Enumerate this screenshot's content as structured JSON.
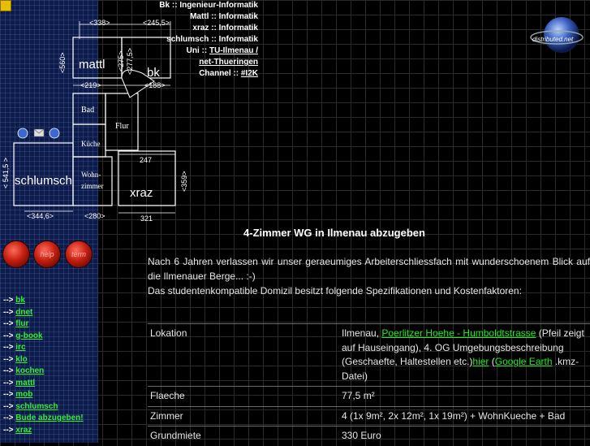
{
  "sidebar_nav": [
    {
      "arrow": "-->",
      "label": "bk"
    },
    {
      "arrow": "-->",
      "label": "dnet"
    },
    {
      "arrow": "-->",
      "label": "flur"
    },
    {
      "arrow": "-->",
      "label": "g-book"
    },
    {
      "arrow": "-->",
      "label": "irc"
    },
    {
      "arrow": "-->",
      "label": "klo"
    },
    {
      "arrow": "-->",
      "label": "kochen"
    },
    {
      "arrow": "-->",
      "label": "mattl"
    },
    {
      "arrow": "-->",
      "label": "mob"
    },
    {
      "arrow": "-->",
      "label": "schlumsch"
    },
    {
      "arrow": "-->",
      "label": "Bude abzugeben!"
    },
    {
      "arrow": "-->",
      "label": "xraz"
    }
  ],
  "round_buttons": [
    "",
    "help",
    "term"
  ],
  "people": [
    {
      "name": "Bk",
      "sep": "::",
      "value": "Ingenieur-Informatik"
    },
    {
      "name": "Mattl",
      "sep": "::",
      "value": "Informatik"
    },
    {
      "name": "xraz",
      "sep": "::",
      "value": "Informatik"
    },
    {
      "name": "schlumsch",
      "sep": "::",
      "value": "Informatik"
    },
    {
      "name": "Uni",
      "sep": "::",
      "value": "TU-Ilmenau /"
    },
    {
      "name": "",
      "sep": "",
      "value": "net-Thueringen"
    },
    {
      "name": "Channel",
      "sep": "::",
      "value": "#I2K"
    }
  ],
  "plan": {
    "rooms": {
      "mattl": "mattl",
      "bk": "bk",
      "bad": "Bad",
      "flur": "Flur",
      "kueche": "Küche",
      "wohn1": "Wohn-",
      "wohn2": "zimmer",
      "schlumsch": "schlumsch",
      "xraz": "xraz"
    },
    "dims": {
      "d338": "<338>",
      "d245": "<245,5>",
      "d560": "<560>",
      "d275": "<275>",
      "d277": "<277,5>",
      "d219": "<219>",
      "d188": "<188>",
      "d247": "247",
      "d359": "<359>",
      "d541": "< 541,5 >",
      "d344": "<344,6>",
      "d280": "<280>",
      "d321": "321"
    }
  },
  "logo_text": "distributed.net",
  "heading": "4-Zimmer WG in Ilmenau abzugeben",
  "intro": {
    "line1": "Nach 6 Jahren verlassen wir unser geraeumiges Arbeiterschliessfach mit wunderschoenem Blick auf die Ilmenauer Berge... :-)",
    "line2": "Das studentenkompatible Domizil besitzt folgende Spezifikationen und Kostenfaktoren:"
  },
  "table": {
    "lokation": {
      "label": "Lokation",
      "p1": "Ilmenau, ",
      "link1": "Poerlitzer Hoehe - Humboldtstrasse",
      "p2": " (Pfeil zeigt auf Hauseingang), 4. OG Umgebungsbeschreibung (Geschaefte, Haltestellen etc.)",
      "link2": "hier",
      "p3": " (",
      "link3": "Google Earth",
      "p4": " .kmz-Datei)"
    },
    "flaeche": {
      "label": "Flaeche",
      "value": "77,5 m²"
    },
    "zimmer": {
      "label": "Zimmer",
      "value": "4 (1x 9m², 2x 12m², 1x 19m²) + WohnKueche + Bad"
    },
    "grundmiete": {
      "label": "Grundmiete",
      "value": "330 Euro"
    }
  }
}
